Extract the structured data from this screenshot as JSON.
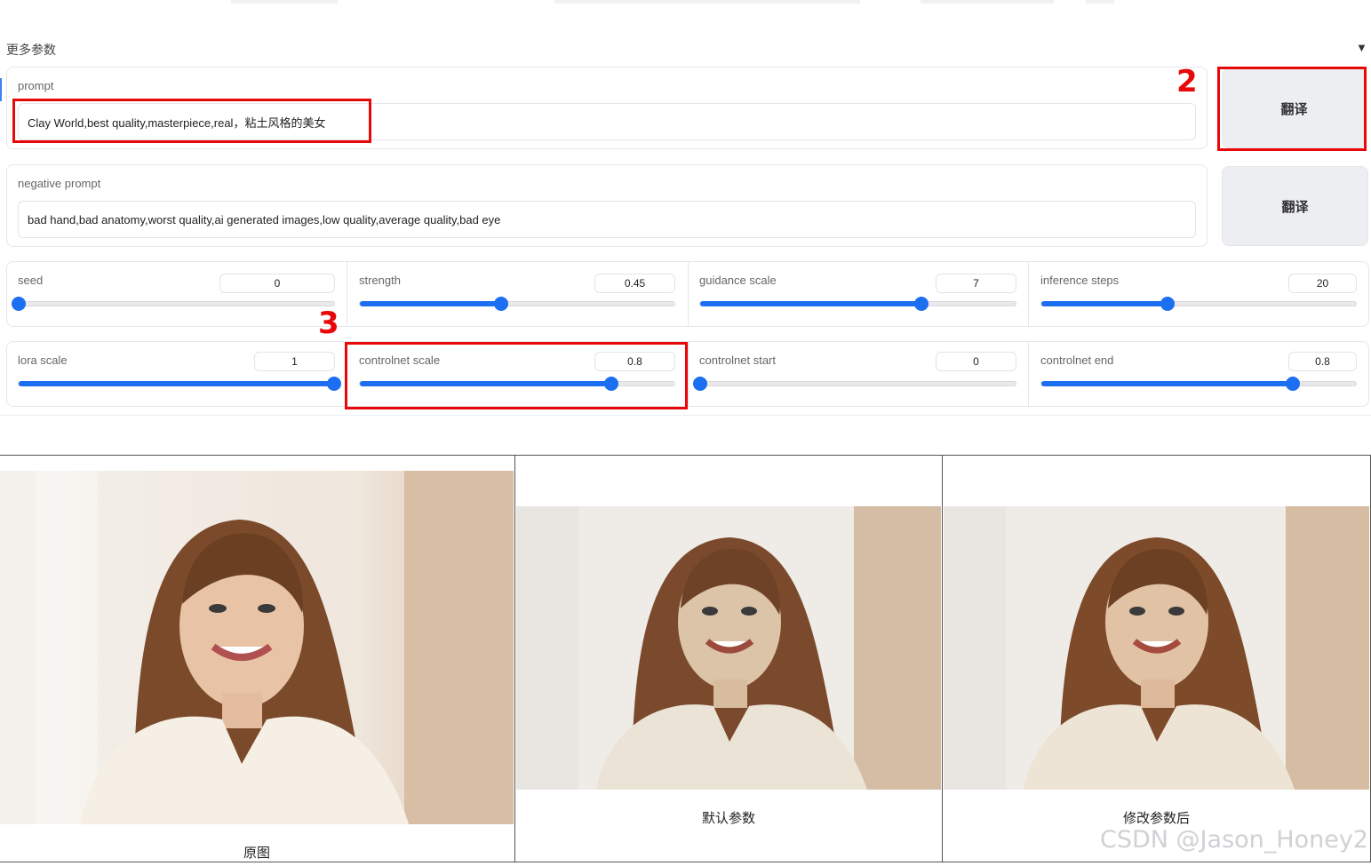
{
  "section": {
    "title": "更多参数",
    "collapse_icon": "triangle-down-icon",
    "collapse_glyph": "▼"
  },
  "prompt": {
    "label": "prompt",
    "value": "Clay World,best quality,masterpiece,real，粘土风格的美女",
    "translate_label": "翻译"
  },
  "negative_prompt": {
    "label": "negative prompt",
    "value": "bad hand,bad anatomy,worst quality,ai generated images,low quality,average quality,bad eye",
    "translate_label": "翻译"
  },
  "sliders": [
    {
      "label": "seed",
      "value": "0",
      "fraction": 0.0
    },
    {
      "label": "strength",
      "value": "0.45",
      "fraction": 0.45
    },
    {
      "label": "guidance scale",
      "value": "7",
      "fraction": 0.7
    },
    {
      "label": "inference steps",
      "value": "20",
      "fraction": 0.4
    },
    {
      "label": "lora scale",
      "value": "1",
      "fraction": 1.0
    },
    {
      "label": "controlnet scale",
      "value": "0.8",
      "fraction": 0.8
    },
    {
      "label": "controlnet start",
      "value": "0",
      "fraction": 0.0
    },
    {
      "label": "controlnet end",
      "value": "0.8",
      "fraction": 0.8
    }
  ],
  "annotations": {
    "marker_2": "2",
    "marker_3": "3",
    "color": "#e8080a"
  },
  "gallery": [
    {
      "caption": "原图"
    },
    {
      "caption": "默认参数"
    },
    {
      "caption": "修改参数后"
    }
  ],
  "watermark": "CSDN @Jason_Honey2",
  "colors": {
    "accent": "#1b6ff0",
    "button_bg": "#eceef2"
  }
}
